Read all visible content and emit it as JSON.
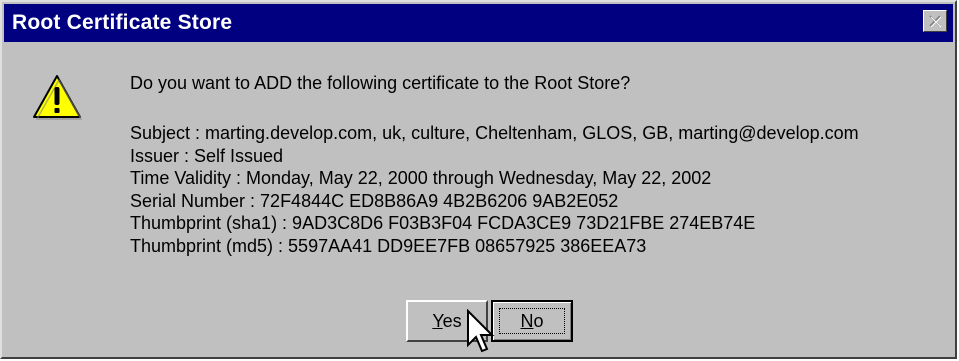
{
  "window": {
    "title": "Root Certificate Store",
    "close_icon": "close-icon"
  },
  "message": {
    "icon": "warning-icon",
    "question": "Do you want to ADD the following certificate to the Root Store?",
    "details": [
      "Subject : marting.develop.com, uk, culture, Cheltenham, GLOS, GB, marting@develop.com",
      "Issuer : Self Issued",
      "Time Validity : Monday, May 22, 2000 through Wednesday, May 22, 2002",
      "Serial Number : 72F4844C ED8B86A9 4B2B6206 9AB2E052",
      "Thumbprint (sha1) : 9AD3C8D6 F03B3F04 FCDA3CE9 73D21FBE 274EB74E",
      "Thumbprint (md5) : 5597AA41 DD9EE7FB 08657925 386EEA73"
    ]
  },
  "buttons": {
    "yes": {
      "accel": "Y",
      "rest": "es"
    },
    "no": {
      "accel": "N",
      "rest": "o"
    }
  },
  "colors": {
    "titlebar": "#000080",
    "face": "#c0c0c0",
    "warning_fill": "#ffff00"
  }
}
